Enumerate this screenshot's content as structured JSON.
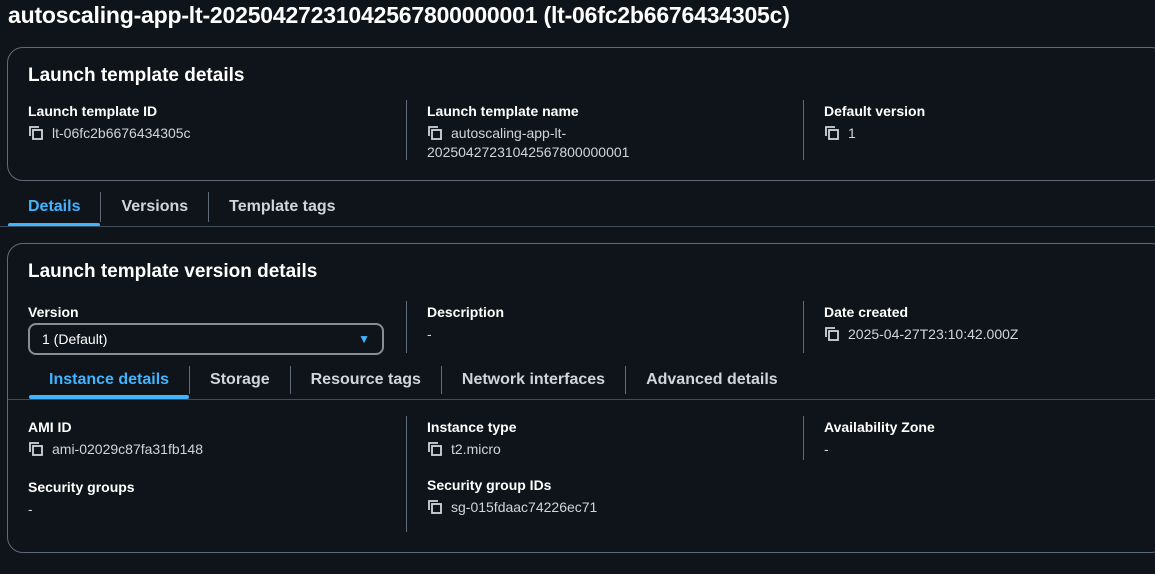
{
  "page": {
    "title": "autoscaling-app-lt-20250427231042567800000001 (lt-06fc2b6676434305c)"
  },
  "template_details": {
    "heading": "Launch template details",
    "id_label": "Launch template ID",
    "id_value": "lt-06fc2b6676434305c",
    "name_label": "Launch template name",
    "name_value_line1": "autoscaling-app-lt-",
    "name_value_line2": "20250427231042567800000001",
    "default_version_label": "Default version",
    "default_version_value": "1"
  },
  "main_tabs": [
    {
      "label": "Details",
      "active": true
    },
    {
      "label": "Versions",
      "active": false
    },
    {
      "label": "Template tags",
      "active": false
    }
  ],
  "version_details": {
    "heading": "Launch template version details",
    "version_label": "Version",
    "version_selected": "1 (Default)",
    "description_label": "Description",
    "description_value": "-",
    "date_label": "Date created",
    "date_value": "2025-04-27T23:10:42.000Z"
  },
  "sub_tabs": [
    {
      "label": "Instance details",
      "active": true
    },
    {
      "label": "Storage",
      "active": false
    },
    {
      "label": "Resource tags",
      "active": false
    },
    {
      "label": "Network interfaces",
      "active": false
    },
    {
      "label": "Advanced details",
      "active": false
    }
  ],
  "instance": {
    "ami_label": "AMI ID",
    "ami_value": "ami-02029c87fa31fb148",
    "type_label": "Instance type",
    "type_value": "t2.micro",
    "az_label": "Availability Zone",
    "az_value": "-",
    "sg_label": "Security groups",
    "sg_value": "-",
    "sgid_label": "Security group IDs",
    "sgid_value": "sg-015fdaac74226ec71"
  },
  "colors": {
    "background": "#0f141a",
    "accent": "#42b4ff",
    "border": "#5f6b7a"
  },
  "icons": {
    "copy": "copy-icon",
    "dropdown": "caret-down-icon"
  }
}
